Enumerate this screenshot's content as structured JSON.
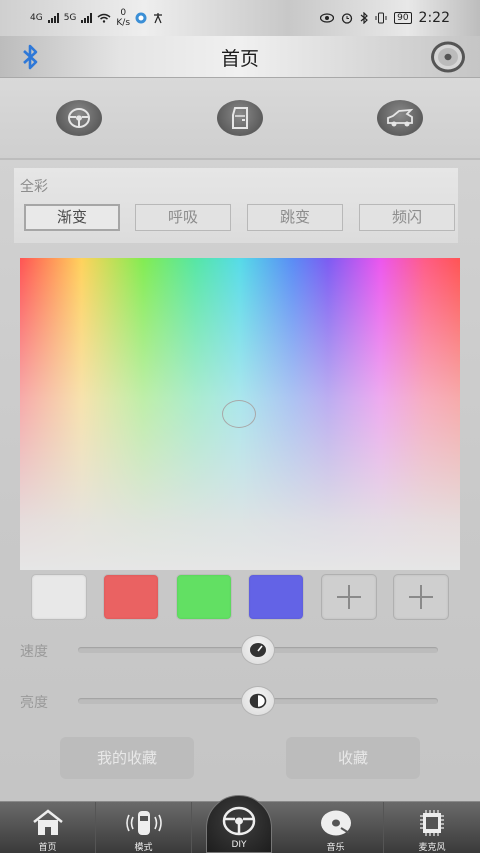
{
  "status_bar": {
    "left_indicators": [
      "4G",
      "5G"
    ],
    "net_speed_value": "0",
    "net_speed_unit": "K/s",
    "battery": "90",
    "time": "2:22"
  },
  "header": {
    "title": "首页"
  },
  "effects": {
    "panel_title": "全彩",
    "buttons": [
      "渐变",
      "呼吸",
      "跳变",
      "频闪"
    ],
    "active_index": 0
  },
  "swatches": {
    "colors": [
      "#e8e8e8",
      "#ea6262",
      "#62e063",
      "#6363e6"
    ]
  },
  "sliders": {
    "speed_label": "速度",
    "speed_value": 0.5,
    "brightness_label": "亮度",
    "brightness_value": 0.5
  },
  "favorites": {
    "my_favorites": "我的收藏",
    "favorite": "收藏"
  },
  "tabs": {
    "items": [
      {
        "label": "首页",
        "icon": "home-icon"
      },
      {
        "label": "模式",
        "icon": "car-signal-icon"
      },
      {
        "label": "DIY",
        "icon": "steering-wheel-icon"
      },
      {
        "label": "音乐",
        "icon": "music-disc-icon"
      },
      {
        "label": "麦克风",
        "icon": "microphone-chip-icon"
      }
    ]
  }
}
